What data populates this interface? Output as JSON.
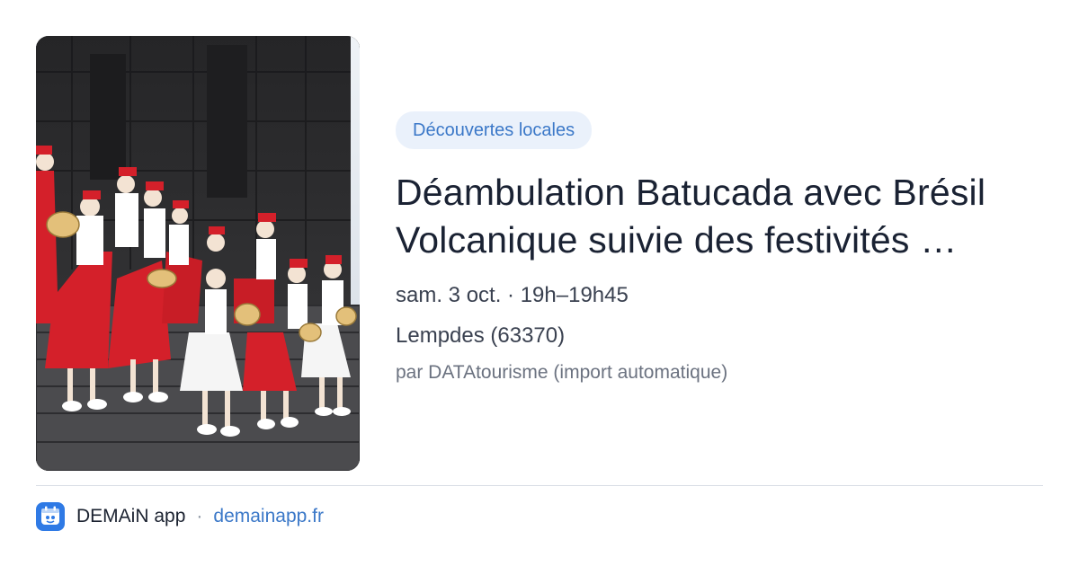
{
  "event": {
    "category": "Découvertes locales",
    "title": "Déambulation Batucada avec Brésil Volcanique suivie des festivités …",
    "datetime": "sam. 3 oct. · 19h–19h45",
    "location": "Lempdes (63370)",
    "source": "par DATAtourisme (import automatique)",
    "image": "photo-batucada-dancers-on-stone-steps"
  },
  "footer": {
    "app_icon": "demain-app-icon",
    "app_name": "DEMAiN app",
    "separator": "·",
    "site": "demainapp.fr"
  },
  "colors": {
    "accent": "#3b78c8",
    "chip_bg": "#eaf1fb",
    "app_icon_bg": "#2f7ae5",
    "costume_red": "#d4202a"
  }
}
